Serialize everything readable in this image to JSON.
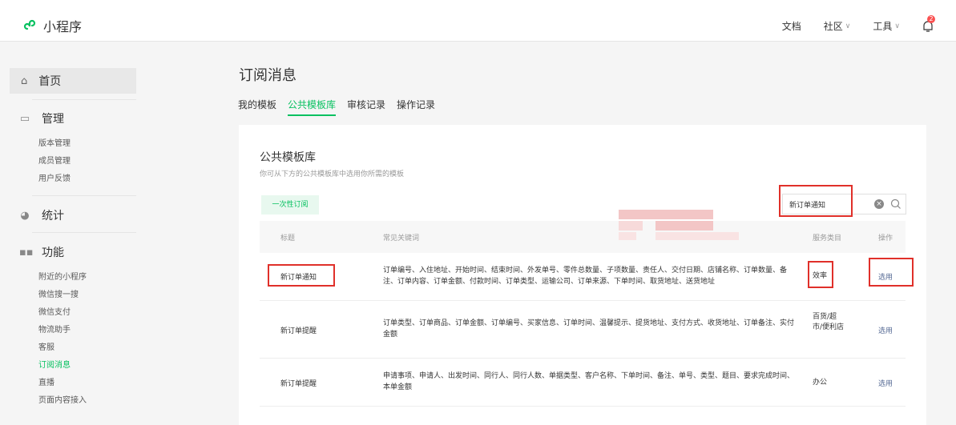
{
  "topbar": {
    "app_name": "小程序",
    "nav": [
      {
        "label": "文档",
        "has_chevron": false
      },
      {
        "label": "社区",
        "has_chevron": true
      },
      {
        "label": "工具",
        "has_chevron": true
      }
    ],
    "notification_badge": "2"
  },
  "sidebar": {
    "home": "首页",
    "groups": [
      {
        "label": "管理",
        "icon": "monitor-icon",
        "items": [
          "版本管理",
          "成员管理",
          "用户反馈"
        ]
      },
      {
        "label": "统计",
        "icon": "pie-chart-icon",
        "items": []
      },
      {
        "label": "功能",
        "icon": "grid-icon",
        "items": [
          "附近的小程序",
          "微信搜一搜",
          "微信支付",
          "物流助手",
          "客服",
          "订阅消息",
          "直播",
          "页面内容接入"
        ]
      }
    ],
    "active_item": "订阅消息"
  },
  "page": {
    "title": "订阅消息",
    "tabs": [
      "我的模板",
      "公共模板库",
      "审核记录",
      "操作记录"
    ],
    "active_tab": "公共模板库"
  },
  "library": {
    "title": "公共模板库",
    "description": "你可从下方的公共模板库中选用你所需的模板",
    "once_button": "一次性订阅",
    "search_value": "新订单通知",
    "columns": {
      "title": "标题",
      "keywords": "常见关键词",
      "service": "服务类目",
      "action": "操作"
    },
    "rows": [
      {
        "title": "新订单通知",
        "keywords": "订单编号、入住地址、开始时间、结束时间、外发单号、零件总数量、子项数量、责任人、交付日期、店铺名称、订单数量、备注、订单内容、订单金额、付款时间、订单类型、运输公司、订单来源、下单时间、取货地址、送货地址",
        "service": "效率",
        "action": "选用"
      },
      {
        "title": "新订单提醒",
        "keywords": "订单类型、订单商品、订单金额、订单编号、买家信息、订单时间、温馨提示、提货地址、支付方式、收货地址、订单备注、实付金额",
        "service": "百货/超市/便利店",
        "action": "选用"
      },
      {
        "title": "新订单提醒",
        "keywords": "申请事项、申请人、出发时间、同行人、同行人数、单据类型、客户名称、下单时间、备注、单号、类型、题目、要求完成时间、本单金额",
        "service": "办公",
        "action": "选用"
      }
    ]
  },
  "colors": {
    "accent": "#07c160",
    "link": "#576b95",
    "highlight_box": "#e0302a"
  }
}
